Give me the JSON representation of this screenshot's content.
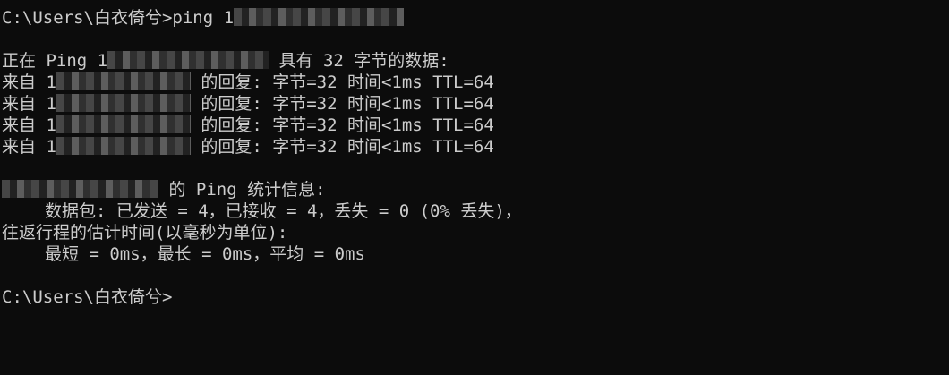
{
  "console": {
    "command_line": {
      "prompt": "C:\\Users\\白衣倚兮>",
      "command": "ping 1"
    },
    "ping_header": {
      "prefix": "正在 Ping 1",
      "suffix": " 具有 32 字节的数据:"
    },
    "replies": [
      {
        "prefix": "来自 1",
        "suffix": " 的回复: 字节=32 时间<1ms TTL=64"
      },
      {
        "prefix": "来自 1",
        "suffix": " 的回复: 字节=32 时间<1ms TTL=64"
      },
      {
        "prefix": "来自 1",
        "suffix": " 的回复: 字节=32 时间<1ms TTL=64"
      },
      {
        "prefix": "来自 1",
        "suffix": " 的回复: 字节=32 时间<1ms TTL=64"
      }
    ],
    "stats_header": {
      "suffix": " 的 Ping 统计信息:"
    },
    "packets_line": "数据包: 已发送 = 4，已接收 = 4，丢失 = 0 (0% 丢失)，",
    "rtt_header": "往返行程的估计时间(以毫秒为单位):",
    "rtt_line": "最短 = 0ms，最长 = 0ms，平均 = 0ms",
    "final_prompt": "C:\\Users\\白衣倚兮>"
  }
}
